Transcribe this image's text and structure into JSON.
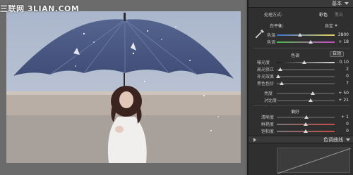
{
  "watermark": {
    "text": "三联网 3LIAN.COM"
  },
  "panel": {
    "header_label": "基本",
    "treatment": {
      "label": "处理方式:",
      "color_opt": "彩色",
      "bw_opt": "黑白"
    },
    "white_balance": {
      "label": "白平衡:",
      "preset": "自定"
    },
    "temp": {
      "label": "色温",
      "value": "3800",
      "pos": 0.4
    },
    "tint": {
      "label": "色调",
      "value": "+ 18",
      "pos": 0.58
    },
    "tone": {
      "label": "色调",
      "auto": "自动"
    },
    "exposure": {
      "label": "曝光度",
      "value": "- 0.10",
      "pos": 0.48
    },
    "recovery": {
      "label": "高光修正",
      "value": "2",
      "pos": 0.06
    },
    "fill": {
      "label": "补光效果",
      "value": "0",
      "pos": 0.02
    },
    "blacks": {
      "label": "黑色色阶",
      "value": "7",
      "pos": 0.08
    },
    "brightness": {
      "label": "亮度",
      "value": "+ 50",
      "pos": 0.62
    },
    "contrast": {
      "label": "对比度",
      "value": "+ 21",
      "pos": 0.58
    },
    "presence": {
      "label": "偏好"
    },
    "clarity": {
      "label": "清晰度",
      "value": "+ 1",
      "pos": 0.51
    },
    "vibrance": {
      "label": "鲜艳度",
      "value": "0",
      "pos": 0.5
    },
    "saturation": {
      "label": "饱和度",
      "value": "0",
      "pos": 0.5
    },
    "curve": {
      "label": "色调曲线"
    }
  },
  "colors": {
    "panel_bg": "#2f2f2f",
    "accent": "#d8d8d8"
  }
}
